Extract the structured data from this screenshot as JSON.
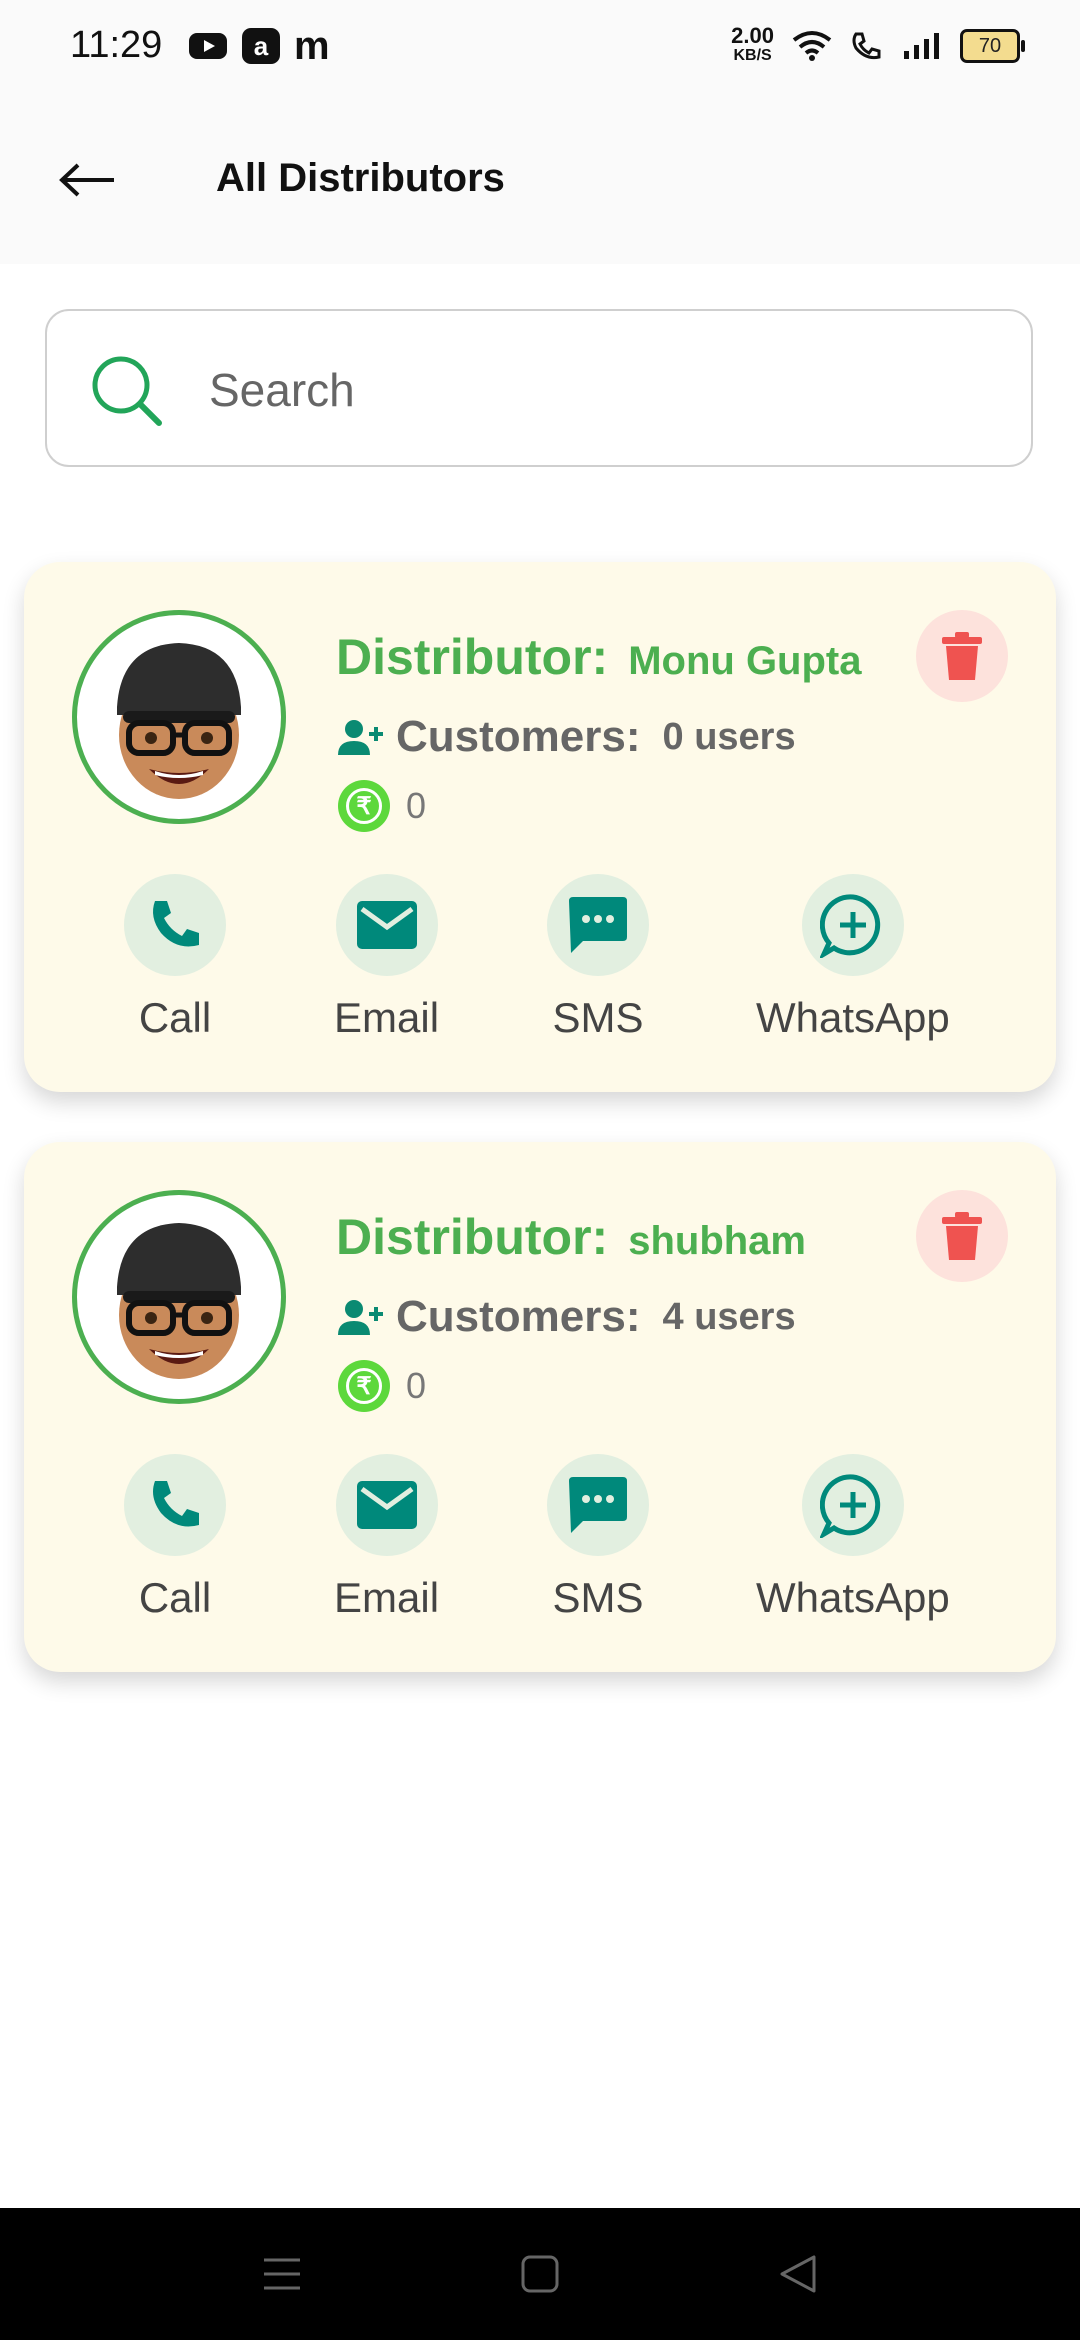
{
  "status_bar": {
    "time": "11:29",
    "app_badge_a": "a",
    "app_badge_m": "m",
    "net_speed_value": "2.00",
    "net_speed_unit": "KB/S",
    "battery": "70"
  },
  "header": {
    "title": "All Distributors",
    "back_icon": "arrow-left-icon"
  },
  "search": {
    "placeholder": "Search",
    "value": ""
  },
  "distributors": [
    {
      "label": "Distributor:",
      "name": "Monu Gupta",
      "customers_label": "Customers:",
      "customers_count": "0 users",
      "balance": "0",
      "actions": [
        "Call",
        "Email",
        "SMS",
        "WhatsApp"
      ]
    },
    {
      "label": "Distributor:",
      "name": "shubham",
      "customers_label": "Customers:",
      "customers_count": "4 users",
      "balance": "0",
      "actions": [
        "Call",
        "Email",
        "SMS",
        "WhatsApp"
      ]
    }
  ],
  "colors": {
    "accent_green": "#4caf50",
    "action_teal": "#00897b",
    "card_bg": "#fefae9",
    "delete_red": "#ef5350"
  }
}
